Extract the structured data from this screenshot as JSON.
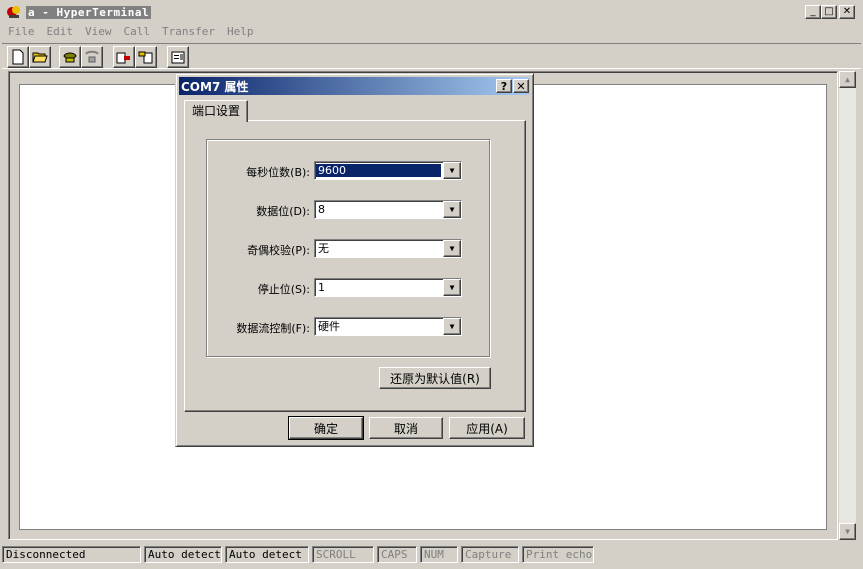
{
  "window": {
    "title": "a - HyperTerminal"
  },
  "menu": [
    "File",
    "Edit",
    "View",
    "Call",
    "Transfer",
    "Help"
  ],
  "toolbar": [
    "new-icon",
    "open-icon",
    "connect-icon",
    "disconnect-icon",
    "send-icon",
    "receive-icon",
    "properties-icon"
  ],
  "status": {
    "connection": "Disconnected",
    "detect1": "Auto detect",
    "detect2": "Auto detect",
    "scroll": "SCROLL",
    "caps": "CAPS",
    "num": "NUM",
    "capture": "Capture",
    "print_echo": "Print echo"
  },
  "dialog": {
    "title": "COM7 属性",
    "help_btn": "?",
    "close_btn": "✕",
    "tab": "端口设置",
    "fields": [
      {
        "label": "每秒位数(B):",
        "value": "9600"
      },
      {
        "label": "数据位(D):",
        "value": "8"
      },
      {
        "label": "奇偶校验(P):",
        "value": "无"
      },
      {
        "label": "停止位(S):",
        "value": "1"
      },
      {
        "label": "数据流控制(F):",
        "value": "硬件"
      }
    ],
    "restore_defaults": "还原为默认值(R)",
    "ok": "确定",
    "cancel": "取消",
    "apply": "应用(A)"
  },
  "colors": {
    "titlebar_active": "#0a246a",
    "face": "#d4d0c8"
  }
}
